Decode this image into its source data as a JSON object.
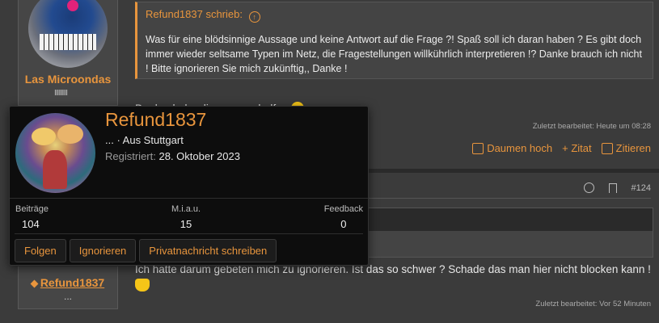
{
  "users": {
    "top": {
      "name": "Las Microondas",
      "rank_bars": "IIIIIIIII"
    },
    "bottom": {
      "name": "Refund1837",
      "extra": "..."
    }
  },
  "post1": {
    "quote_header": "Refund1837 schrieb:",
    "quote_text": "Was für eine blödsinnige Aussage und keine Antwort auf die Frage ?! Spaß soll ich daran haben ? Es gibt doch immer wieder seltsame Typen im Netz, die Fragestellungen willkührlich interpretieren !? Danke brauch ich nicht ! Bitte ignorieren Sie mich zukünftig,, Danke !",
    "text": "Danke, habe dir gerne geholfen",
    "edited": "Zuletzt bearbeitet: Heute um 08:28",
    "actions": {
      "like": "Daumen hoch",
      "quote": "+ Zitat",
      "reply": "Zitieren"
    }
  },
  "post2": {
    "number": "#124",
    "text": "Ich hatte darum gebeten mich zu ignorieren. Ist das so schwer ? Schade das man hier nicht blocken kann !",
    "edited": "Zuletzt bearbeitet: Vor 52 Minuten"
  },
  "card": {
    "name": "Refund1837",
    "location": "... · Aus Stuttgart",
    "registered_label": "Registriert:",
    "registered_date": "28. Oktober 2023",
    "stats": [
      {
        "label": "Beiträge",
        "value": "104"
      },
      {
        "label": "M.i.a.u.",
        "value": "15"
      },
      {
        "label": "Feedback",
        "value": "0"
      }
    ],
    "buttons": {
      "follow": "Folgen",
      "ignore": "Ignorieren",
      "message": "Privatnachricht schreiben"
    }
  }
}
